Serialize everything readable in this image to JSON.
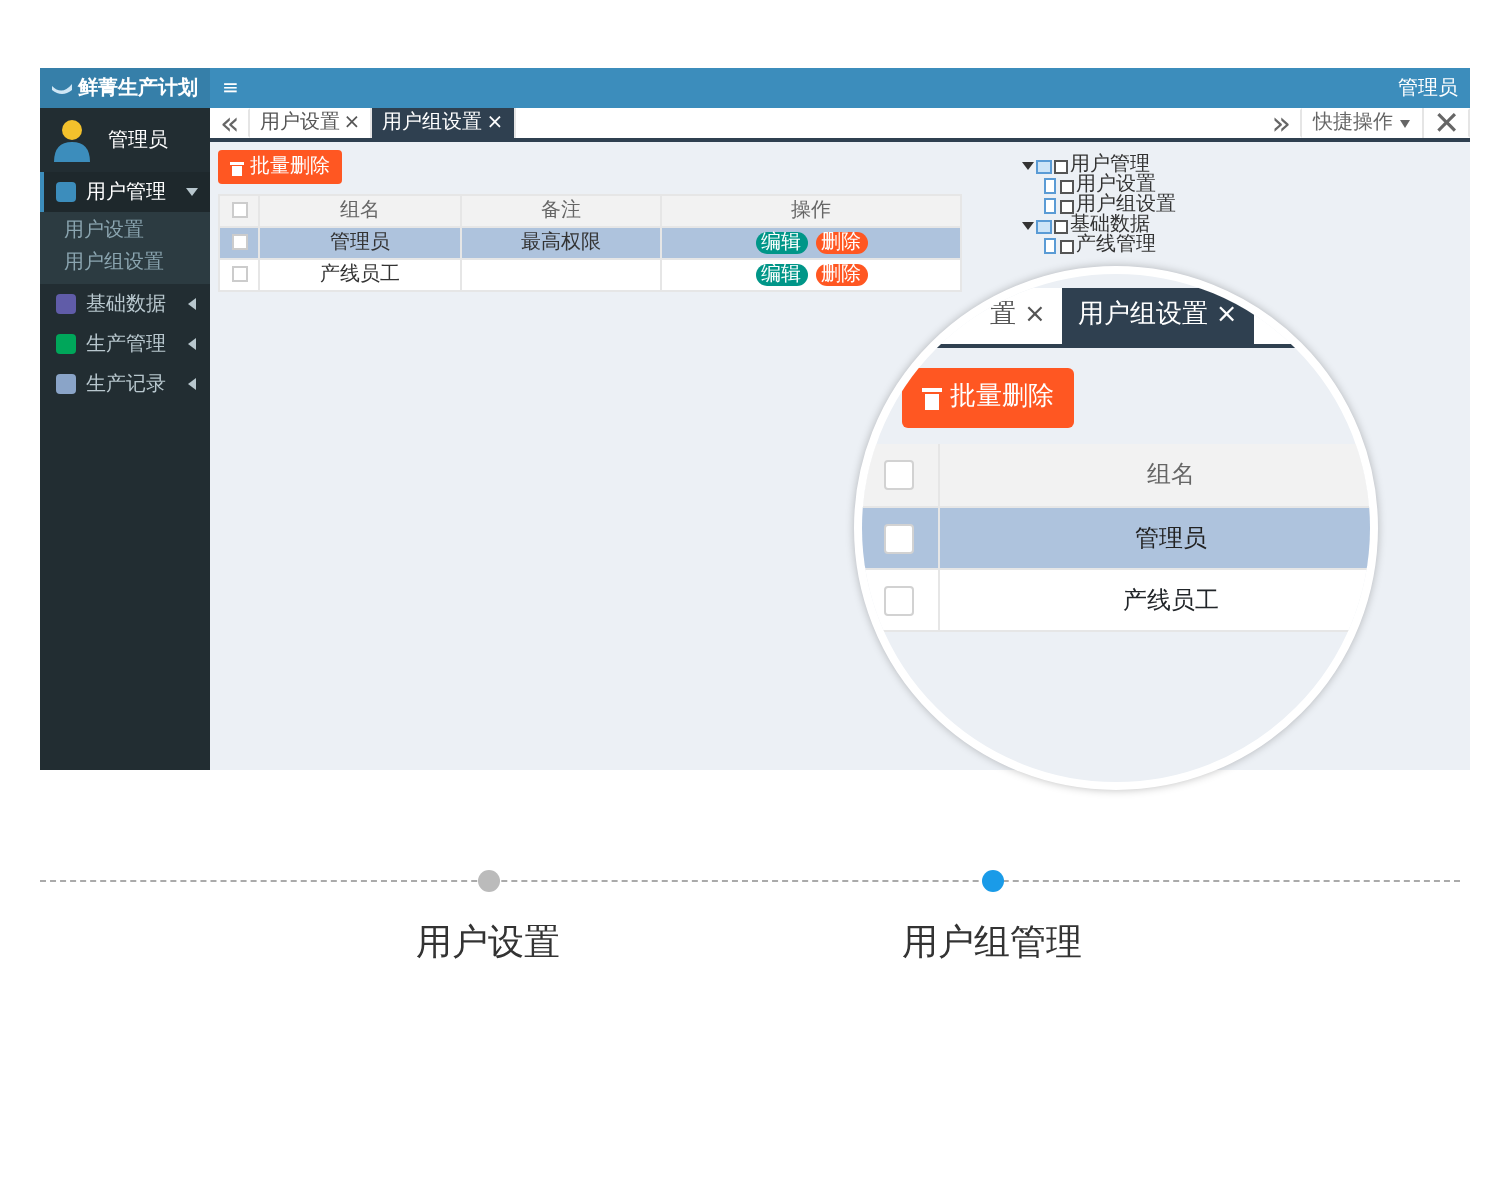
{
  "app": {
    "logo": "鲜菁生产计划",
    "user": "管理员",
    "menu": [
      {
        "label": "用户管理",
        "color": "#3c8dbc",
        "expanded": true,
        "selected": true,
        "children": [
          {
            "label": "用户设置"
          },
          {
            "label": "用户组设置"
          }
        ]
      },
      {
        "label": "基础数据",
        "color": "#605ca8",
        "expanded": false,
        "selected": false
      },
      {
        "label": "生产管理",
        "color": "#00a65a",
        "expanded": false,
        "selected": false
      },
      {
        "label": "生产记录",
        "color": "#8aa4c8",
        "expanded": false,
        "selected": false
      }
    ],
    "topbar": {
      "toggle": "≡",
      "user": "管理员"
    },
    "tab_tools": {
      "prev": "«",
      "next": "»",
      "quick_ops": "快捷操作",
      "close": "✕"
    },
    "tabs": [
      {
        "label": "用户设置",
        "close": "×",
        "selected": false
      },
      {
        "label": "用户组设置",
        "close": "×",
        "selected": true
      }
    ],
    "batch_delete": "批量删除",
    "table": {
      "header_checked": false,
      "columns": [
        "组名",
        "备注",
        "操作"
      ],
      "rows": [
        {
          "name": "管理员",
          "note": "最高权限",
          "selected": true,
          "checked": false,
          "actions": [
            {
              "label": "编辑",
              "kind": "edit"
            },
            {
              "label": "删除",
              "kind": "delete"
            }
          ]
        },
        {
          "name": "产线员工",
          "selected": false,
          "checked": false,
          "actions": [
            {
              "label": "编辑",
              "kind": "edit"
            },
            {
              "label": "删除",
              "kind": "delete"
            }
          ]
        }
      ]
    },
    "tree": [
      {
        "label": "用户管理",
        "expanded": true,
        "checked": false,
        "children": [
          {
            "label": "用户设置",
            "checked": false
          },
          {
            "label": "用户组设置",
            "checked": false
          }
        ]
      },
      {
        "label": "基础数据",
        "expanded": true,
        "checked": false,
        "children": [
          {
            "label": "产线管理",
            "checked": false
          }
        ]
      }
    ]
  },
  "magnifier": {
    "tabs": [
      {
        "label": "置",
        "close": "×",
        "selected": false
      },
      {
        "label": "用户组设置",
        "close": "×",
        "selected": true
      }
    ],
    "batch_delete": "批量删除",
    "header_checked": false,
    "column": "组名",
    "rows": [
      {
        "name": "管理员",
        "selected": true,
        "checked": false
      },
      {
        "name": "产线员工",
        "selected": false,
        "checked": false
      }
    ]
  },
  "steps": [
    {
      "label": "用户设置",
      "selected": false
    },
    {
      "label": "用户组管理",
      "selected": true
    }
  ]
}
